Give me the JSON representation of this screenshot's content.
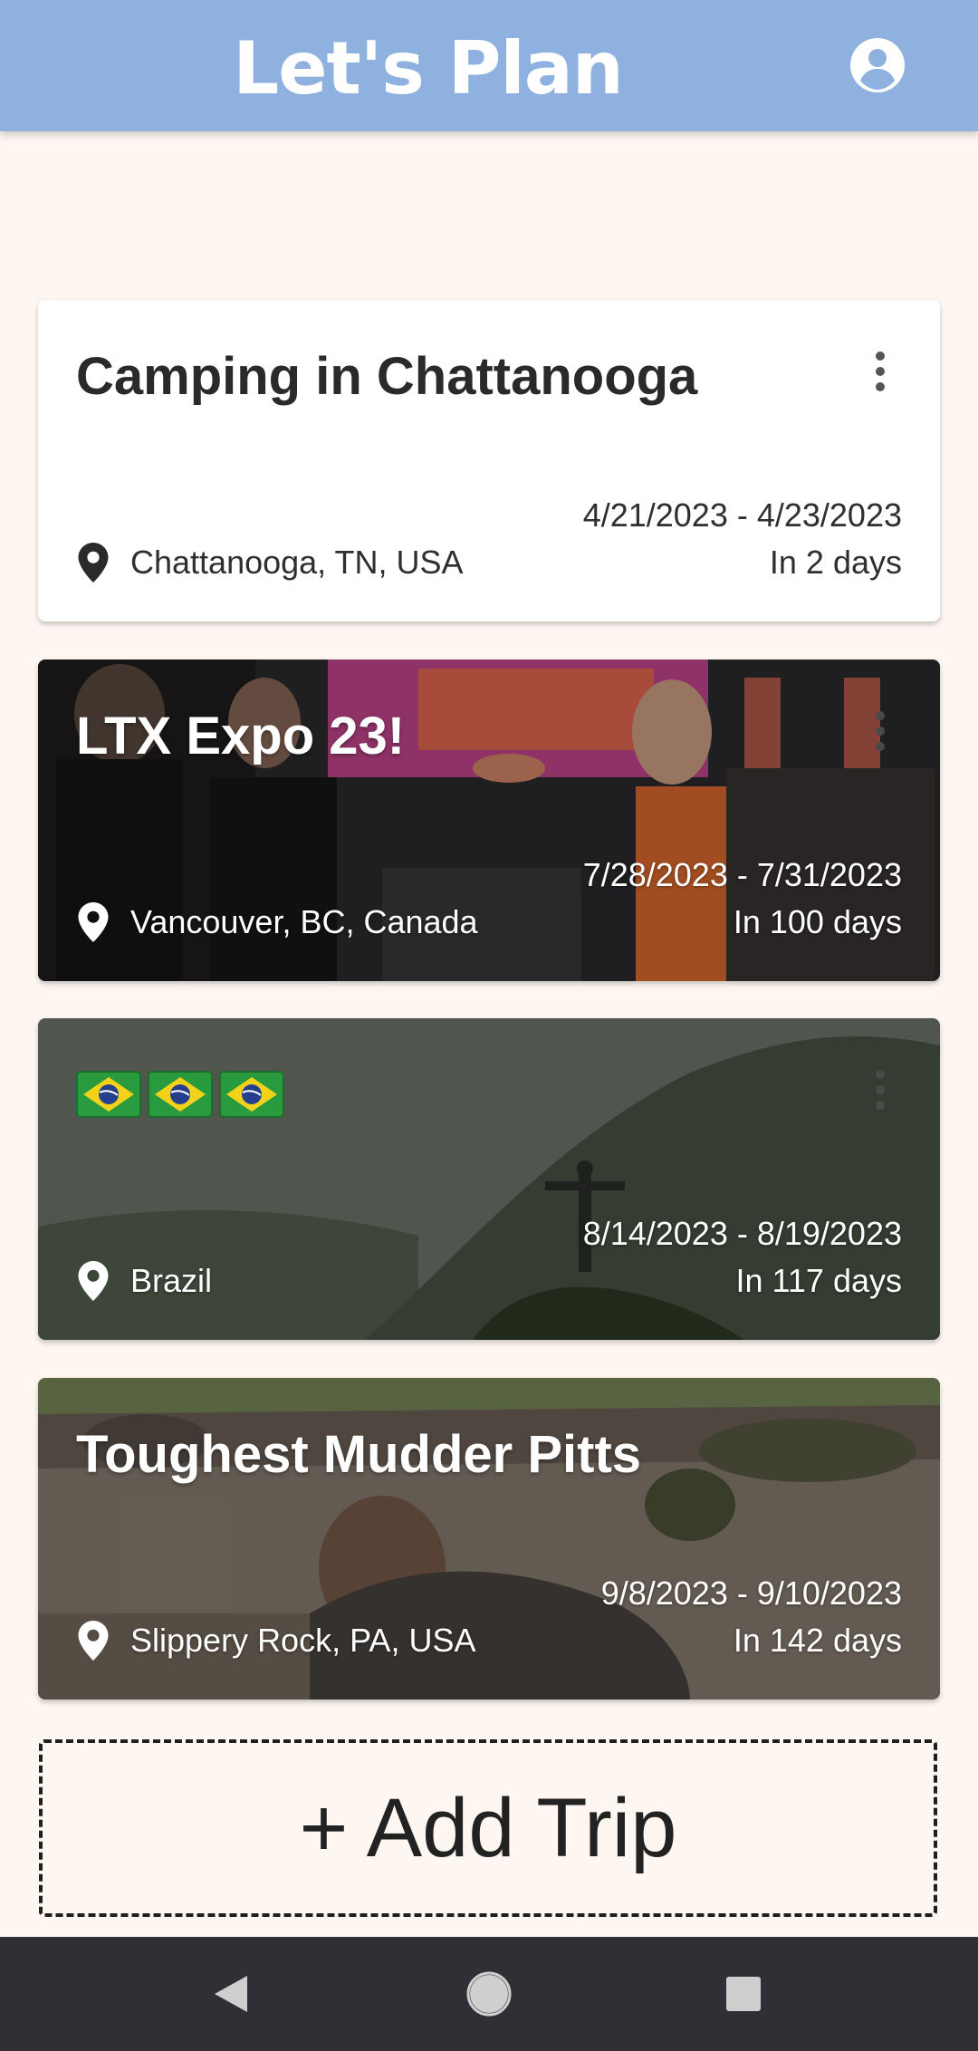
{
  "header": {
    "title": "Let's Plan",
    "account_icon": "account-circle-icon",
    "background_color": "#8eb1e0"
  },
  "trips": [
    {
      "title": "Camping in Chattanooga",
      "location": "Chattanooga, TN, USA",
      "date_range": "4/21/2023 - 4/23/2023",
      "countdown": "In 2 days",
      "has_photo": false
    },
    {
      "title": "LTX Expo 23!",
      "location": "Vancouver, BC, Canada",
      "date_range": "7/28/2023 - 7/31/2023",
      "countdown": "In 100 days",
      "has_photo": true
    },
    {
      "title": "🇧🇷🇧🇷🇧🇷",
      "location": "Brazil",
      "date_range": "8/14/2023 - 8/19/2023",
      "countdown": "In 117 days",
      "has_photo": true
    },
    {
      "title": "Toughest Mudder Pitts",
      "location": "Slippery Rock, PA, USA",
      "date_range": "9/8/2023 - 9/10/2023",
      "countdown": "In 142 days",
      "has_photo": true
    }
  ],
  "add_trip": {
    "label": "+ Add Trip"
  },
  "icons": {
    "menu": "more-vert-icon",
    "location": "location-pin-icon",
    "back": "back-triangle-icon",
    "home": "home-circle-icon",
    "recents": "recents-square-icon"
  },
  "colors": {
    "page_background": "#fdf6f1",
    "nav_bar": "#2f2f35"
  }
}
